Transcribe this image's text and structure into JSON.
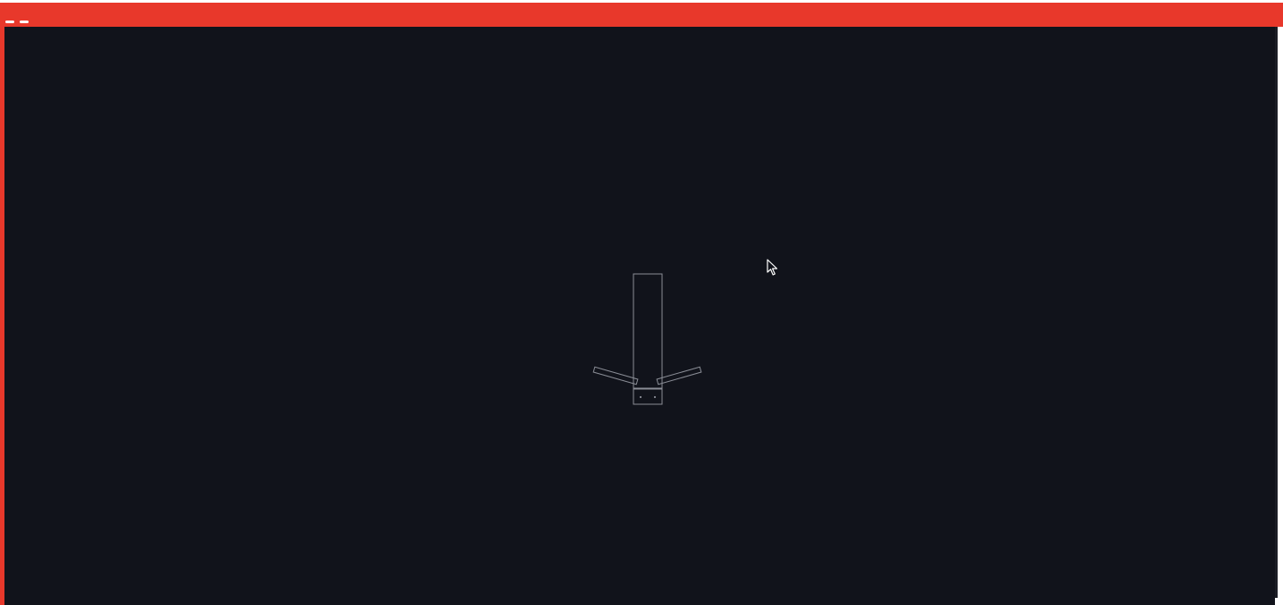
{
  "window": {
    "titlebar_color": "#e8382b",
    "canvas_color": "#11131b",
    "controls": [
      "window-control-a",
      "window-control-b"
    ]
  },
  "scene": {
    "stroke_color": "#8a8d96",
    "shapes": [
      "tall-body-rectangle",
      "left-arm",
      "right-arm",
      "head-box",
      "left-eye",
      "right-eye"
    ]
  },
  "cursor": {
    "icon": "arrow-cursor-icon"
  }
}
